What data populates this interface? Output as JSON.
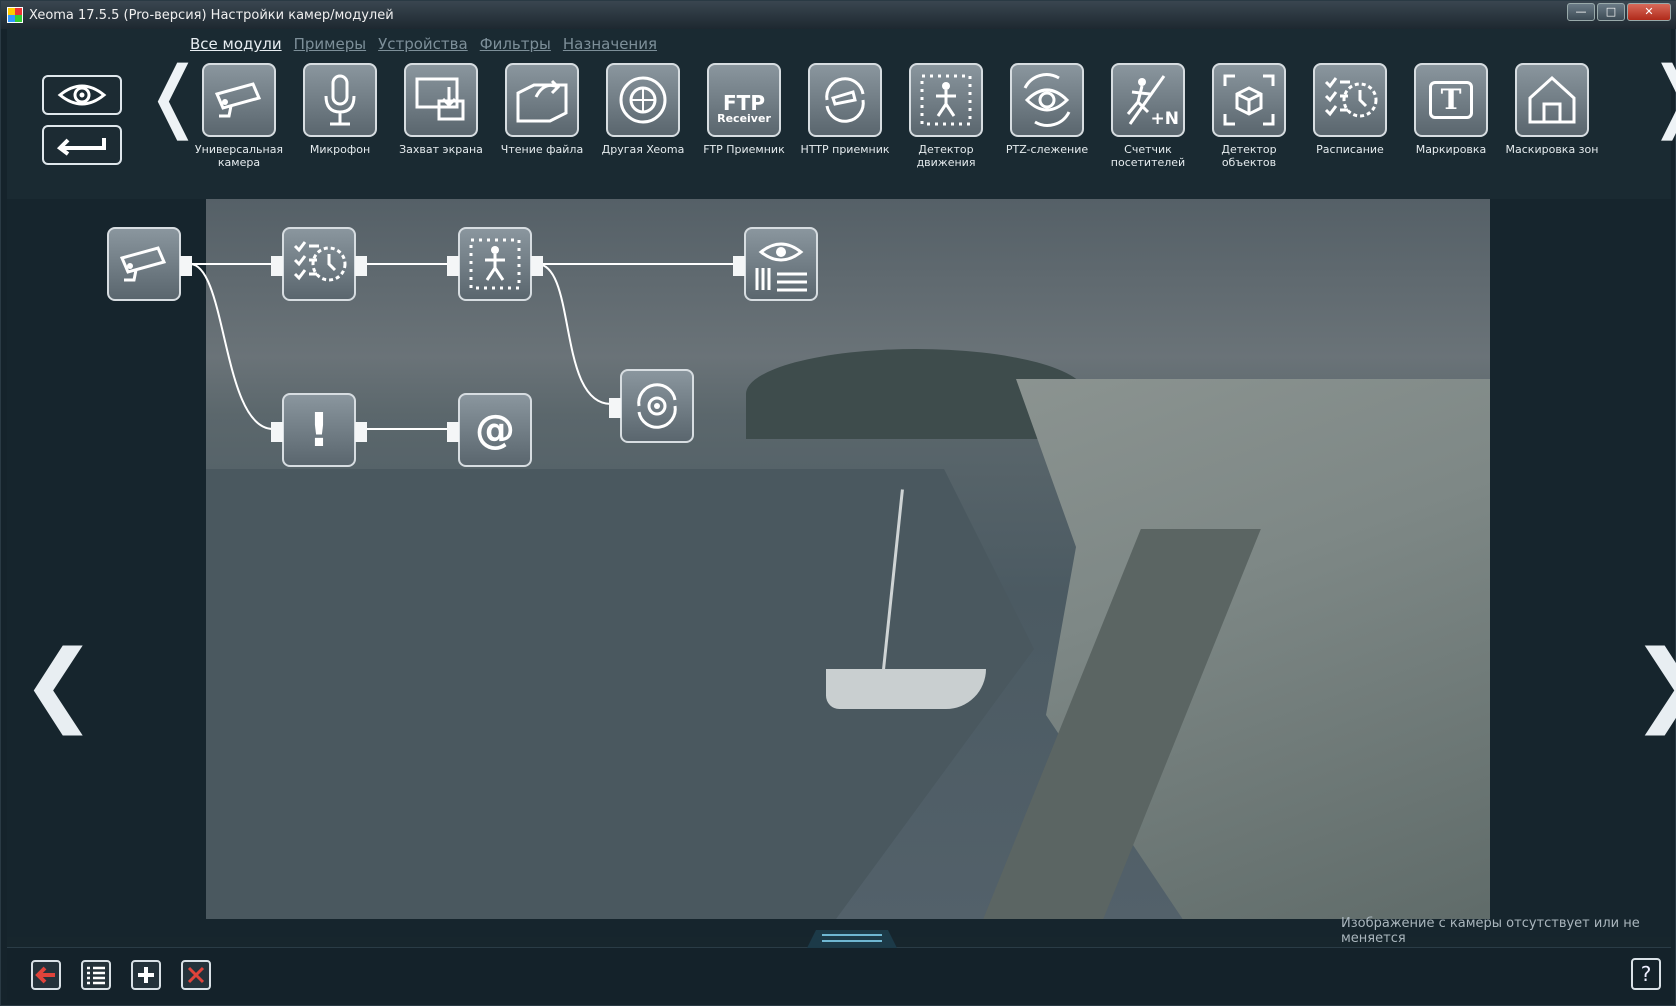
{
  "window": {
    "title": "Xeoma 17.5.5 (Pro-версия) Настройки камер/модулей"
  },
  "filters": [
    "Все модули",
    "Примеры",
    "Устройства",
    "Фильтры",
    "Назначения"
  ],
  "modules": [
    {
      "label": "Универсальная камера",
      "icon": "camera-icon"
    },
    {
      "label": "Микрофон",
      "icon": "microphone-icon"
    },
    {
      "label": "Захват экрана",
      "icon": "screen-capture-icon"
    },
    {
      "label": "Чтение файла",
      "icon": "file-reading-icon"
    },
    {
      "label": "Другая Xeoma",
      "icon": "other-xeoma-icon"
    },
    {
      "label": "FTP Приемник",
      "icon": "ftp-receiver-icon",
      "ftp_text": "FTP",
      "ftp_sub": "Receiver"
    },
    {
      "label": "HTTP приемник",
      "icon": "http-receiver-icon"
    },
    {
      "label": "Детектор движения",
      "icon": "motion-detector-icon"
    },
    {
      "label": "PTZ-слежение",
      "icon": "ptz-tracking-icon"
    },
    {
      "label": "Счетчик посетителей",
      "icon": "visitors-counter-icon",
      "badge": "+N"
    },
    {
      "label": "Детектор объектов",
      "icon": "object-detector-icon"
    },
    {
      "label": "Расписание",
      "icon": "schedule-icon"
    },
    {
      "label": "Маркировка",
      "icon": "marking-icon",
      "letter": "T"
    },
    {
      "label": "Маскировка зон",
      "icon": "privacy-masking-icon"
    }
  ],
  "chain_nodes": [
    {
      "id": "camera",
      "icon": "camera-icon"
    },
    {
      "id": "schedule",
      "icon": "schedule-icon"
    },
    {
      "id": "motion",
      "icon": "motion-detector-icon"
    },
    {
      "id": "viewer",
      "icon": "preview-archive-icon"
    },
    {
      "id": "ptz",
      "icon": "ptz-icon"
    },
    {
      "id": "alert",
      "icon": "problems-detector-icon",
      "text": "!"
    },
    {
      "id": "email",
      "icon": "email-icon",
      "text": "@"
    }
  ],
  "status": "Изображение с камеры отсутствует или не меняется",
  "bottom_buttons": [
    "exit-icon",
    "list-icon",
    "add-icon",
    "delete-icon"
  ],
  "help": "?",
  "colors": {
    "accent": "#6fb7d2",
    "panel": "#1a2a32",
    "exit": "#e0433a"
  }
}
